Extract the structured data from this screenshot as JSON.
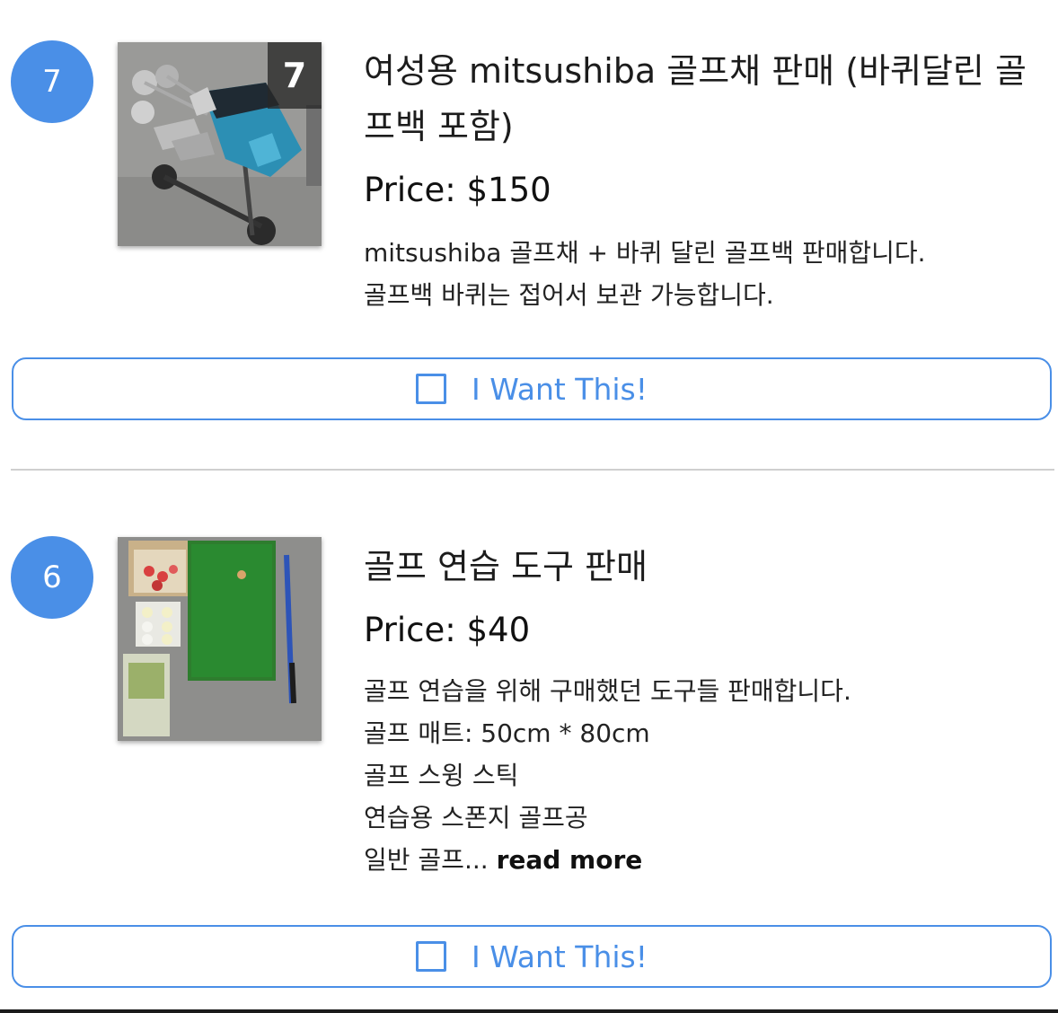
{
  "listings": [
    {
      "number": "7",
      "photo_count": "7",
      "image_desc": "golf-bag-with-clubs",
      "title": "여성용 mitsushiba 골프채 판매 (바퀴달린 골프백 포함)",
      "price": "Price: $150",
      "description": [
        "mitsushiba 골프채 + 바퀴 달린 골프백 판매합니다.",
        "골프백 바퀴는 접어서 보관 가능합니다."
      ],
      "button_label": "I Want This!"
    },
    {
      "number": "6",
      "image_desc": "golf-practice-items",
      "title": "골프 연습 도구 판매",
      "price": "Price: $40",
      "description": [
        "골프 연습을 위해 구매했던 도구들 판매합니다.",
        "골프 매트: 50cm * 80cm",
        "골프 스윙 스틱",
        "연습용 스폰지 골프공"
      ],
      "truncated_text": "일반 골프...",
      "read_more_label": "read more",
      "button_label": "I Want This!"
    }
  ],
  "colors": {
    "accent": "#4a8fe7",
    "divider": "#cfcfcf"
  }
}
